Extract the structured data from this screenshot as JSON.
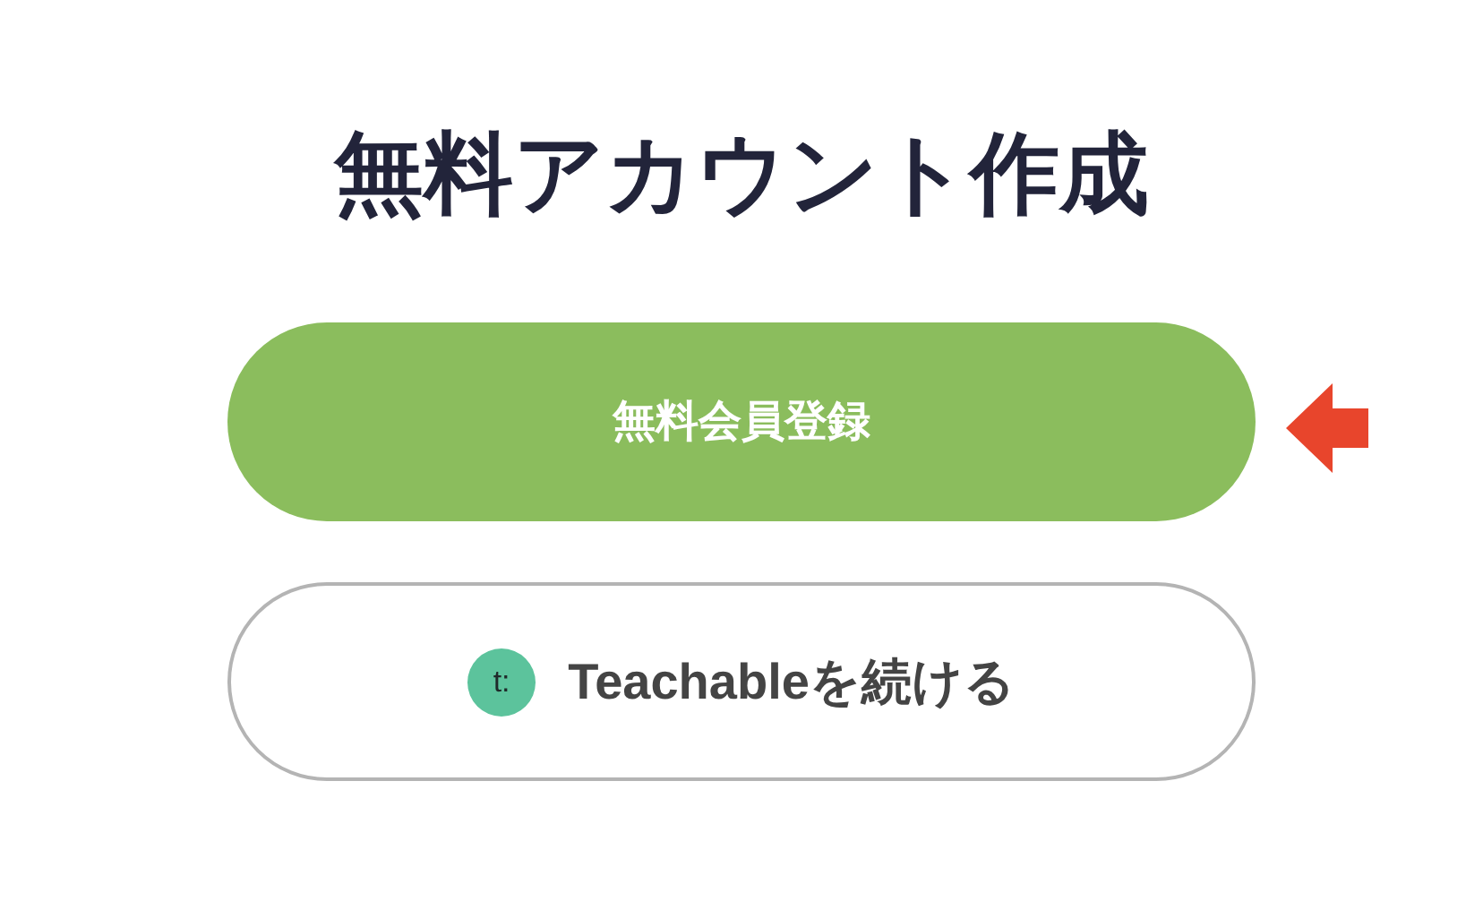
{
  "title": "無料アカウント作成",
  "buttons": [
    {
      "kind": "primary",
      "label": "無料会員登録",
      "pointed": true
    },
    {
      "kind": "teachable",
      "logo": "t:",
      "label": "Teachableを続ける",
      "pointed": false
    }
  ]
}
